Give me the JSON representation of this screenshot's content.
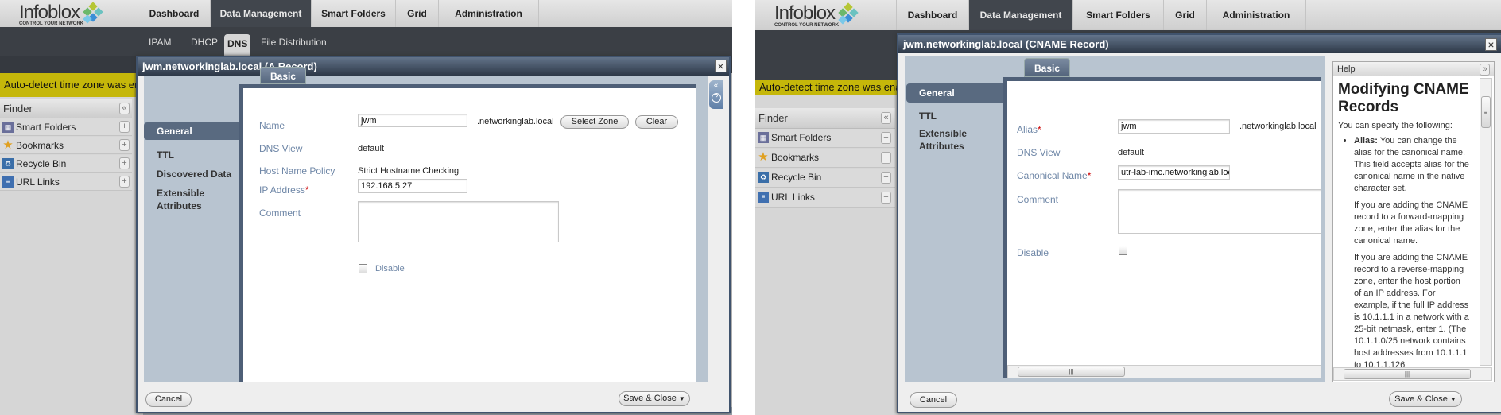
{
  "app": {
    "logo": "Infoblox",
    "tagline": "CONTROL YOUR NETWORK",
    "tabs": [
      "Dashboard",
      "Data Management",
      "Smart Folders",
      "Grid",
      "Administration"
    ],
    "subtabs": [
      "IPAM",
      "DHCP",
      "DNS",
      "File Distribution"
    ],
    "banner": "Auto-detect time zone was ena",
    "finder": {
      "title": "Finder",
      "items": [
        "Smart Folders",
        "Bookmarks",
        "Recycle Bin",
        "URL Links"
      ]
    }
  },
  "left_dialog": {
    "title": "jwm.networkinglab.local (A Record)",
    "nav": [
      "General",
      "TTL",
      "Discovered Data",
      "Extensible Attributes"
    ],
    "tab": "Basic",
    "fields": {
      "name_label": "Name",
      "name_value": "jwm",
      "zone_suffix": ".networkinglab.local",
      "select_zone": "Select Zone",
      "clear": "Clear",
      "dns_view_label": "DNS View",
      "dns_view_value": "default",
      "host_policy_label": "Host Name Policy",
      "host_policy_value": "Strict Hostname Checking",
      "ip_label": "IP Address",
      "ip_value": "192.168.5.27",
      "required": "*",
      "comment_label": "Comment",
      "comment_value": "",
      "disable_label": "Disable",
      "disable_checked": false
    },
    "cancel": "Cancel",
    "save": "Save & Close"
  },
  "right_dialog": {
    "title": "jwm.networkinglab.local (CNAME Record)",
    "nav": [
      "General",
      "TTL",
      "Extensible Attributes"
    ],
    "tab": "Basic",
    "fields": {
      "alias_label": "Alias",
      "alias_value": "jwm",
      "zone_suffix": ".networkinglab.local",
      "dns_view_label": "DNS View",
      "dns_view_value": "default",
      "canonical_label": "Canonical Name",
      "canonical_value": "utr-lab-imc.networkinglab.loc",
      "comment_label": "Comment",
      "comment_value": "",
      "disable_label": "Disable",
      "disable_checked": false,
      "required": "*"
    },
    "help": {
      "title": "Help",
      "heading": "Modifying CNAME Records",
      "intro": "You can specify the following:",
      "bullet_term": "Alias:",
      "bullet_text": "You can change the alias for the canonical name. This field accepts alias for the canonical name in the native character set.",
      "p1": "If you are adding the CNAME record to a forward-mapping zone, enter the alias for the canonical name.",
      "p2": "If you are adding the CNAME record to a reverse-mapping zone, enter the host portion of an IP address. For example, if the full IP address is 10.1.1.1 in a network with a 25-bit netmask, enter 1. (The 10.1.1.0/25 network contains host addresses from 10.1.1.1 to 10.1.1.126"
    },
    "cancel": "Cancel",
    "save": "Save & Close"
  }
}
